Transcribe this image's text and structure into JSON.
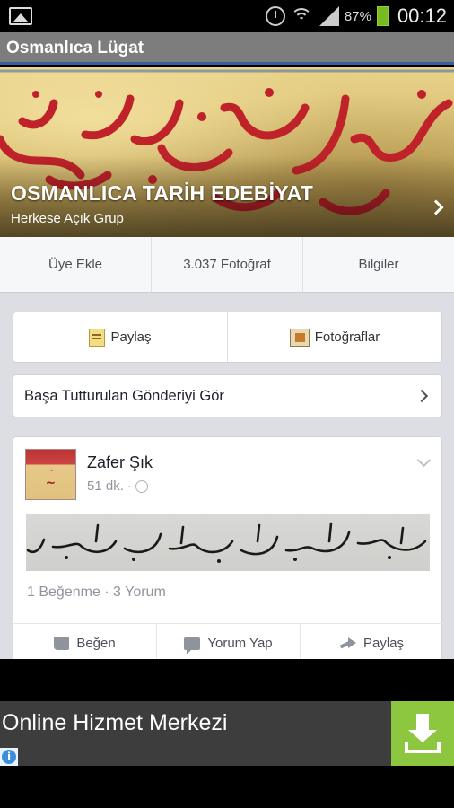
{
  "status_bar": {
    "battery_percent": "87%",
    "time": "00:12",
    "icons": [
      "gallery-icon",
      "alarm-icon",
      "wifi-icon",
      "signal-icon",
      "battery-icon"
    ]
  },
  "app_bar": {
    "title": "Osmanlıca Lügat"
  },
  "group": {
    "name": "OSMANLICA TARİH EDEBİYAT",
    "privacy": "Herkese Açık Grup"
  },
  "tabs": [
    {
      "label": "Üye Ekle"
    },
    {
      "label": "3.037 Fotoğraf"
    },
    {
      "label": "Bilgiler"
    }
  ],
  "actions": {
    "share_label": "Paylaş",
    "photos_label": "Fotoğraflar"
  },
  "pinned": {
    "label": "Başa Tutturulan Gönderiyi Gör"
  },
  "post": {
    "author": "Zafer Şık",
    "time": "51 dk.",
    "separator": "·",
    "counts": "1 Beğenme · 3 Yorum",
    "like_label": "Beğen",
    "comment_label": "Yorum Yap",
    "share_label": "Paylaş"
  },
  "ad": {
    "title": "Online Hizmet Merkezi",
    "info_glyph": "i"
  },
  "colors": {
    "app_bar_bg": "#7d7d7d",
    "app_bar_accent": "#3a5ea0",
    "content_bg": "#dcdee3",
    "ad_bg": "#3d3d3d",
    "ad_download_bg": "#8dc63f"
  }
}
